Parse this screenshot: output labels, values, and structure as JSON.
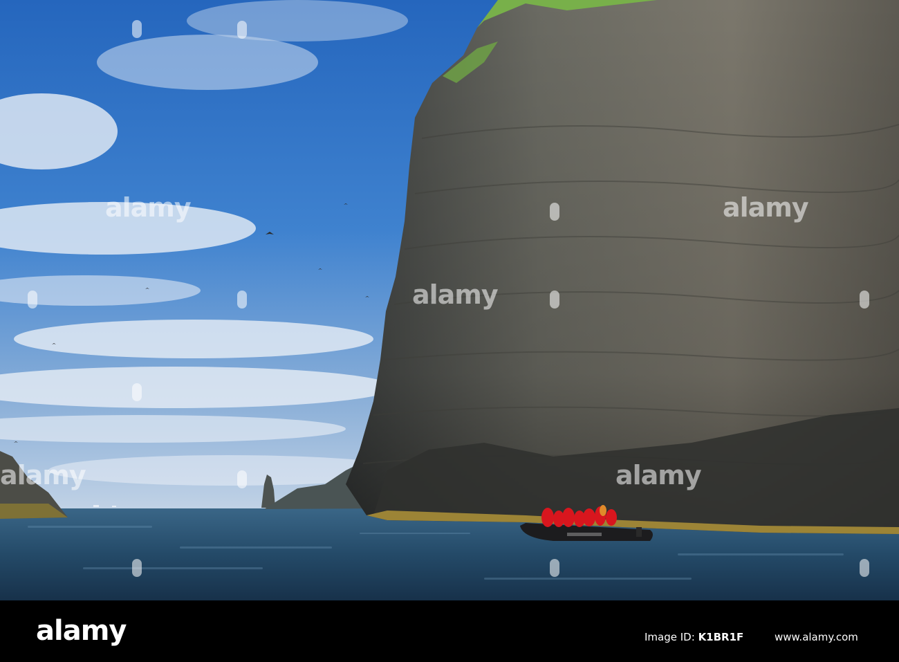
{
  "colors": {
    "sky_top": "#2a6fc2",
    "sky_horizon": "#b9cde4",
    "sea": "#2a4e6d",
    "cliff": "#5e5d56",
    "grass": "#7fb552",
    "jackets": "#d8161e",
    "banner": "#000000"
  },
  "photo": {
    "description_icons": [
      "cliff",
      "sea-stack",
      "inflatable-boat",
      "birds"
    ]
  },
  "watermark": {
    "text": "alamy"
  },
  "banner": {
    "logo_text": "alamy",
    "image_id_label": "Image ID:",
    "image_id_value": "K1BR1F",
    "website": "www.alamy.com"
  }
}
